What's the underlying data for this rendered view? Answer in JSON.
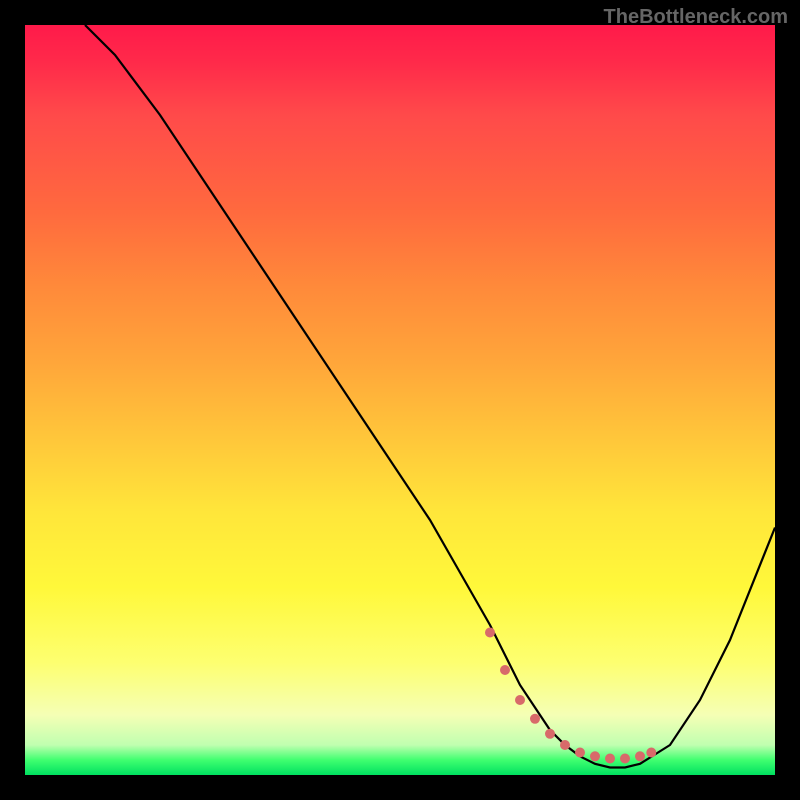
{
  "watermark": "TheBottleneck.com",
  "chart_data": {
    "type": "line",
    "title": "",
    "xlabel": "",
    "ylabel": "",
    "xlim": [
      0,
      100
    ],
    "ylim": [
      0,
      100
    ],
    "series": [
      {
        "name": "curve",
        "x": [
          8,
          12,
          18,
          24,
          30,
          36,
          42,
          48,
          54,
          58,
          62,
          64,
          66,
          68,
          70,
          72,
          74,
          76,
          78,
          80,
          82,
          86,
          90,
          94,
          100
        ],
        "y": [
          100,
          96,
          88,
          79,
          70,
          61,
          52,
          43,
          34,
          27,
          20,
          16,
          12,
          9,
          6,
          4,
          2.5,
          1.5,
          1,
          1,
          1.5,
          4,
          10,
          18,
          33
        ]
      }
    ],
    "markers": {
      "name": "dots",
      "x": [
        62,
        64,
        66,
        68,
        70,
        72,
        74,
        76,
        78,
        80,
        82,
        83.5
      ],
      "y": [
        19,
        14,
        10,
        7.5,
        5.5,
        4,
        3,
        2.5,
        2.2,
        2.2,
        2.5,
        3
      ]
    },
    "gradient_stops": [
      {
        "pos": 0.0,
        "color": "#ff1a4a"
      },
      {
        "pos": 0.25,
        "color": "#ff6a3e"
      },
      {
        "pos": 0.55,
        "color": "#ffc63a"
      },
      {
        "pos": 0.85,
        "color": "#fdff70"
      },
      {
        "pos": 0.98,
        "color": "#40ff70"
      },
      {
        "pos": 1.0,
        "color": "#00e060"
      }
    ]
  }
}
